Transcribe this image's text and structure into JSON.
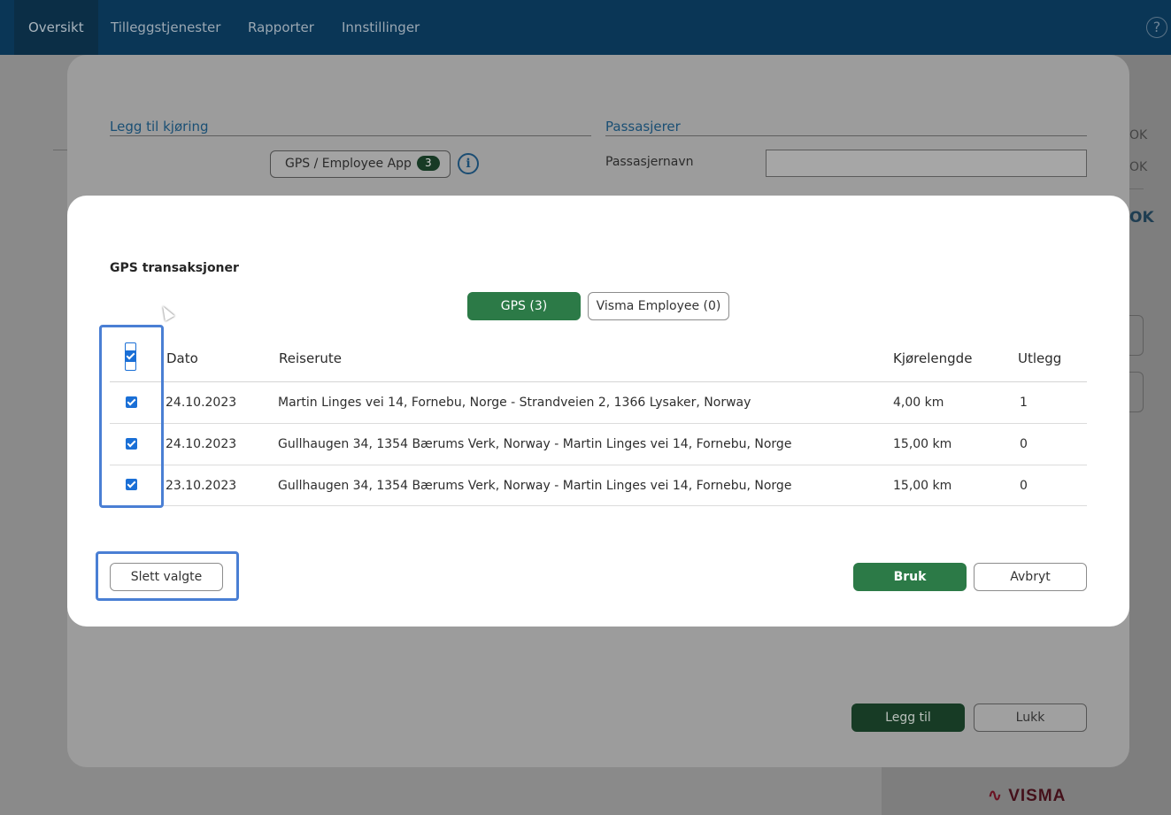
{
  "nav": {
    "items": [
      "Oversikt",
      "Tilleggstjenester",
      "Rapporter",
      "Innstillinger"
    ],
    "help": "?"
  },
  "background": {
    "ok_labels": [
      "OK",
      "OK",
      "OK"
    ],
    "logo": "VISMA"
  },
  "trip_modal": {
    "section_left": "Legg til kjøring",
    "section_right": "Passasjerer",
    "gps_button_label": "GPS / Employee App",
    "gps_count": "3",
    "info": "i",
    "passenger_label": "Passasjernavn",
    "passenger_value": "",
    "add_button": "Legg til",
    "close_button": "Lukk"
  },
  "gps_modal": {
    "title": "GPS transaksjoner",
    "tabs": [
      {
        "label": "GPS (3)",
        "active": true
      },
      {
        "label": "Visma Employee (0)",
        "active": false
      }
    ],
    "columns": [
      "Dato",
      "Reiserute",
      "Kjørelengde",
      "Utlegg"
    ],
    "select_all_checked": true,
    "rows": [
      {
        "checked": true,
        "date": "24.10.2023",
        "route": "Martin Linges vei 14, Fornebu, Norge - Strandveien 2, 1366 Lysaker, Norway",
        "distance": "4,00 km",
        "expense": "1"
      },
      {
        "checked": true,
        "date": "24.10.2023",
        "route": "Gullhaugen 34, 1354 Bærums Verk, Norway - Martin Linges vei 14, Fornebu, Norge",
        "distance": "15,00 km",
        "expense": "0"
      },
      {
        "checked": true,
        "date": "23.10.2023",
        "route": "Gullhaugen 34, 1354 Bærums Verk, Norway - Martin Linges vei 14, Fornebu, Norge",
        "distance": "15,00 km",
        "expense": "0"
      }
    ],
    "delete_button": "Slett valgte",
    "apply_button": "Bruk",
    "cancel_button": "Avbryt"
  },
  "colors": {
    "primary_green": "#2c7a47",
    "nav_bg": "#0a3656",
    "checkbox_blue": "#1a6fd6",
    "highlight_blue": "#4a7fd4"
  }
}
